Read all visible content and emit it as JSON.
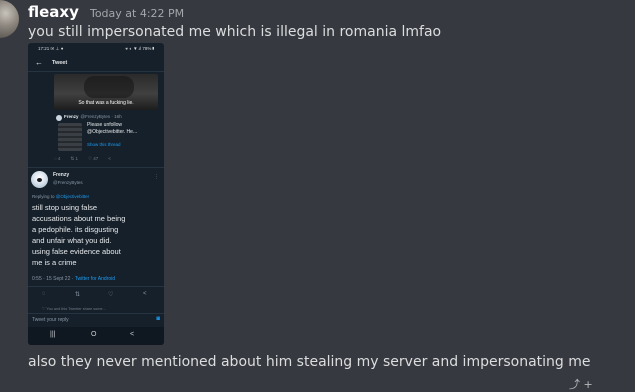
{
  "message": {
    "username": "fleaxy",
    "timestamp": "Today at 4:22 PM",
    "text_1": "you still impersonated me which is illegal in romania lmfao",
    "text_2": "also they never mentioned about him stealing my server and impersonating me"
  },
  "attachment": {
    "status_time": "17:21 ✉ ⊥ ●",
    "status_right": "⚹ ◐ ▼.ıl 78%▮",
    "back_glyph": "←",
    "page_title": "Tweet",
    "video_caption": "So that was a fucking lie.",
    "quoted": {
      "name": "Frenzy",
      "handle": "@FrenzyBytes · 16h",
      "text": "Please unfollow\n@Objectivebitter. He...",
      "link": "Show this thread"
    },
    "quoted_actions": [
      "◌ 4",
      "⇅ 1",
      "♡ 47",
      "<"
    ],
    "tweet": {
      "name": "Frenzy",
      "handle": "@FrenzyBytes",
      "more": "⋮",
      "replying_prefix": "Replying to ",
      "replying_handle": "@Objectivebitter",
      "body": "still stop using false\naccusations about me being\na pedophile. its disgusting\nand unfair what you did.\nusing false evidence about\nme is a crime",
      "time": "0:55 · 15 Sept 22 · ",
      "source": "Twitter for Android"
    },
    "actions": [
      "◌",
      "⇅",
      "♡",
      "<"
    ],
    "liked_line": "♡ You and this Tweeter share some...",
    "reply_placeholder": "Tweet your reply",
    "camera_glyph": "◙",
    "nav": [
      "|||",
      "O",
      "<"
    ]
  },
  "corner_icons": "⤴ +"
}
